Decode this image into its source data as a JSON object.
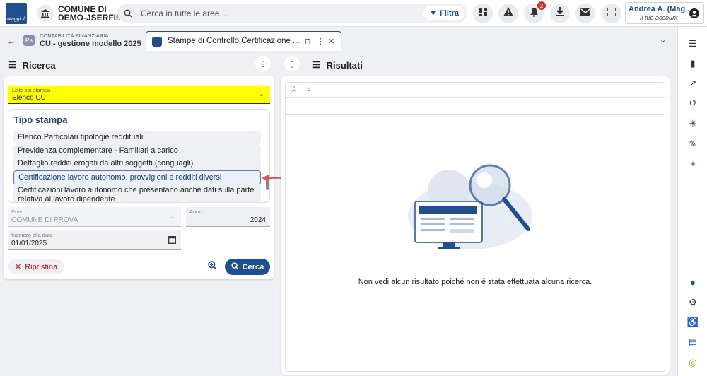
{
  "topbar": {
    "logo_text": "Maggioli",
    "ente_line1": "COMUNE DI",
    "ente_line2": "DEMO-JSERFIN",
    "search_placeholder": "Cerca in tutte le aree...",
    "filter_label": "Filtra",
    "notif_count": "2",
    "user_name": "Andrea A. (Mag...",
    "user_sub": "Il tuo account"
  },
  "tabs": {
    "tab1_small": "CONTABILITÀ FINANZIARIA",
    "tab1_title": "CU - gestione modello 2025",
    "tab1_icon": "Ra",
    "tab2_title": "Stampe di Controllo Certificazione ..."
  },
  "left": {
    "title": "Ricerca",
    "select_label": "Liste tipi stampa",
    "select_value": "Elenco CU",
    "tipo_title": "Tipo stampa",
    "items": [
      "Elenco Particolari tipologie reddituali",
      "Previdenza complementare - Familiari a carico",
      "Dettaglio redditi erogati da altri soggetti (conguagli)",
      "Certificazione lavoro autonomo, provvigioni e redditi diversi",
      "Certificazioni lavoro autonomo che presentano anche dati sulla parte relativa al lavoro dipendente"
    ],
    "ente_label": "Ente",
    "ente_value": "COMUNE DI PROVA",
    "anno_label": "Anno",
    "anno_value": "2024",
    "data_label": "Indirizzo alla data",
    "data_value": "01/01/2025",
    "btn_reset": "Ripristina",
    "btn_search": "Cerca"
  },
  "right": {
    "title": "Risultati",
    "empty_text": "Non vedi alcun risultato poiché non è stata effettuata alcuna ricerca."
  },
  "colors": {
    "primary": "#1f4f8f",
    "highlight": "#ffff00",
    "arrow": "#d9534f"
  }
}
